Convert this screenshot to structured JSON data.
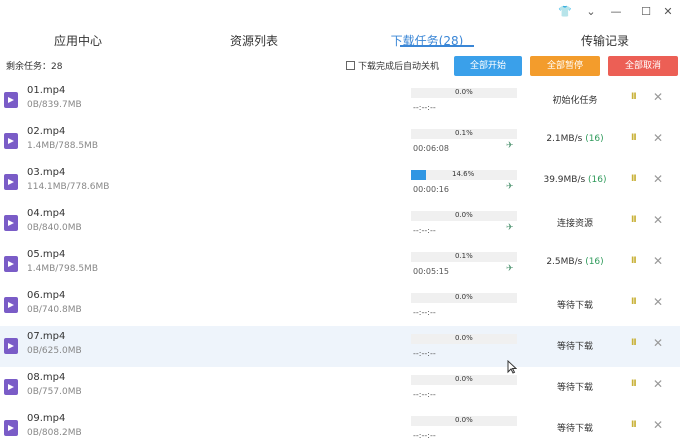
{
  "window": {
    "controls": {
      "shirt": "👕",
      "dropdown": "⌄",
      "minimize": "—",
      "maximize": "☐",
      "close": "✕"
    }
  },
  "tabs": [
    {
      "label": "应用中心"
    },
    {
      "label": "资源列表"
    },
    {
      "label": "下载任务(28)"
    },
    {
      "label": "传输记录"
    }
  ],
  "toolbar": {
    "remaining": "剩余任务：28",
    "shutdown_label": "下载完成后自动关机",
    "start_all": "全部开始",
    "pause_all": "全部暂停",
    "cancel_all": "全部取消"
  },
  "tasks": [
    {
      "name": "01.mp4",
      "size": "0B/839.7MB",
      "progress": 0.0,
      "percent": "0.0%",
      "time": "--:--:--",
      "status": "初始化任务",
      "count": "",
      "speed_icon": false
    },
    {
      "name": "02.mp4",
      "size": "1.4MB/788.5MB",
      "progress": 0.1,
      "percent": "0.1%",
      "time": "00:06:08",
      "status": "2.1MB/s",
      "count": "(16)",
      "speed_icon": true
    },
    {
      "name": "03.mp4",
      "size": "114.1MB/778.6MB",
      "progress": 14.6,
      "percent": "14.6%",
      "time": "00:00:16",
      "status": "39.9MB/s",
      "count": "(16)",
      "speed_icon": true
    },
    {
      "name": "04.mp4",
      "size": "0B/840.0MB",
      "progress": 0.0,
      "percent": "0.0%",
      "time": "--:--:--",
      "status": "连接资源",
      "count": "",
      "speed_icon": true
    },
    {
      "name": "05.mp4",
      "size": "1.4MB/798.5MB",
      "progress": 0.1,
      "percent": "0.1%",
      "time": "00:05:15",
      "status": "2.5MB/s",
      "count": "(16)",
      "speed_icon": true
    },
    {
      "name": "06.mp4",
      "size": "0B/740.8MB",
      "progress": 0.0,
      "percent": "0.0%",
      "time": "--:--:--",
      "status": "等待下载",
      "count": "",
      "speed_icon": false
    },
    {
      "name": "07.mp4",
      "size": "0B/625.0MB",
      "progress": 0.0,
      "percent": "0.0%",
      "time": "--:--:--",
      "status": "等待下载",
      "count": "",
      "speed_icon": false
    },
    {
      "name": "08.mp4",
      "size": "0B/757.0MB",
      "progress": 0.0,
      "percent": "0.0%",
      "time": "--:--:--",
      "status": "等待下载",
      "count": "",
      "speed_icon": false
    },
    {
      "name": "09.mp4",
      "size": "0B/808.2MB",
      "progress": 0.0,
      "percent": "0.0%",
      "time": "--:--:--",
      "status": "等待下载",
      "count": "",
      "speed_icon": false
    }
  ],
  "actions": {
    "pause_glyph": "II",
    "delete_glyph": "✕",
    "speed_glyph": "✈"
  },
  "colors": {
    "accent": "#3a86d6",
    "progress": "#2f96e3",
    "start": "#3aa0ea",
    "pause": "#f39c2c",
    "cancel": "#ec5f55"
  }
}
